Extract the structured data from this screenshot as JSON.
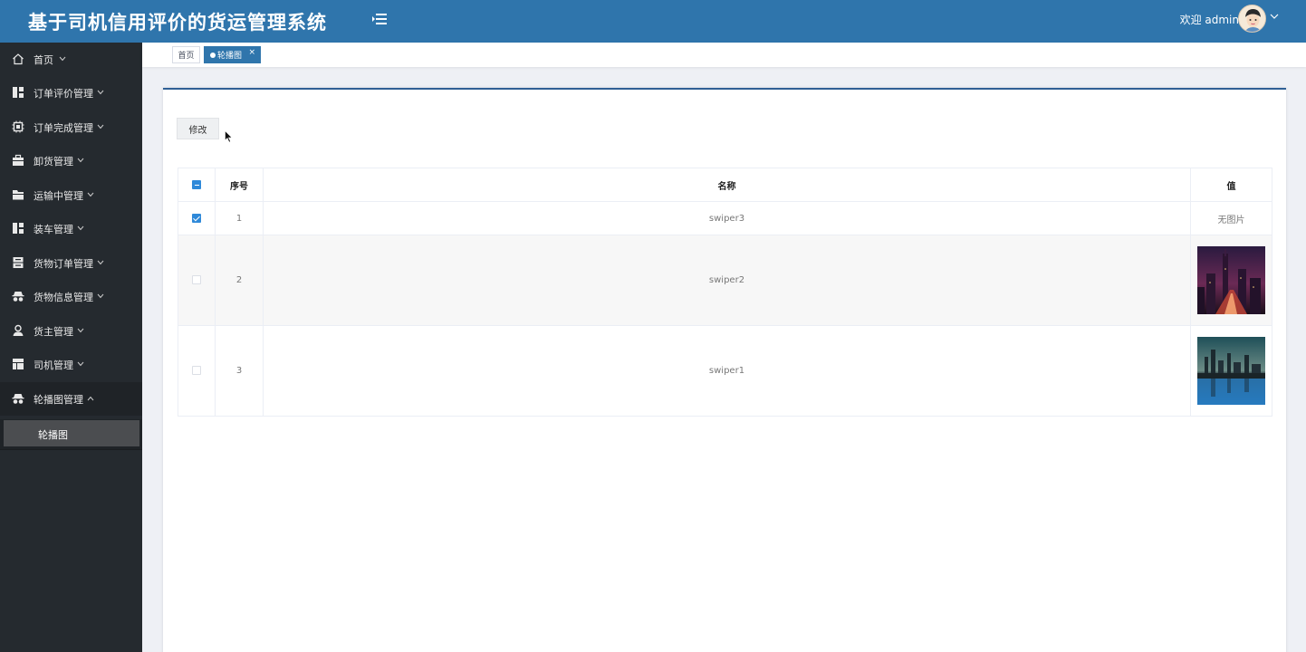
{
  "header": {
    "title": "基于司机信用评价的货运管理系统",
    "welcome": "欢迎 admin"
  },
  "sidebar": {
    "items": [
      {
        "label": "首页",
        "icon": "home-icon"
      },
      {
        "label": "订单评价管理",
        "icon": "grid-icon"
      },
      {
        "label": "订单完成管理",
        "icon": "chip-icon"
      },
      {
        "label": "卸货管理",
        "icon": "toolbox-icon"
      },
      {
        "label": "运输中管理",
        "icon": "folder-icon"
      },
      {
        "label": "装车管理",
        "icon": "grid-icon"
      },
      {
        "label": "货物订单管理",
        "icon": "server-icon"
      },
      {
        "label": "货物信息管理",
        "icon": "incognito-icon"
      },
      {
        "label": "货主管理",
        "icon": "user-icon"
      },
      {
        "label": "司机管理",
        "icon": "layout-icon"
      },
      {
        "label": "轮播图管理",
        "icon": "incognito-icon"
      }
    ],
    "active_sub": "轮播图"
  },
  "tabs": [
    {
      "label": "首页"
    },
    {
      "label": "轮播图",
      "close": "×"
    }
  ],
  "toolbar": {
    "edit_label": "修改"
  },
  "table": {
    "headers": [
      "序号",
      "名称",
      "值"
    ],
    "rows": [
      {
        "idx": "1",
        "name": "swiper3",
        "value": "无图片",
        "checked": true
      },
      {
        "idx": "2",
        "name": "swiper2",
        "value": "",
        "checked": false
      },
      {
        "idx": "3",
        "name": "swiper1",
        "value": "",
        "checked": false
      }
    ]
  },
  "colors": {
    "header": "#2f75ac",
    "sidebar": "#252a2f",
    "accent": "#2f89d9"
  }
}
